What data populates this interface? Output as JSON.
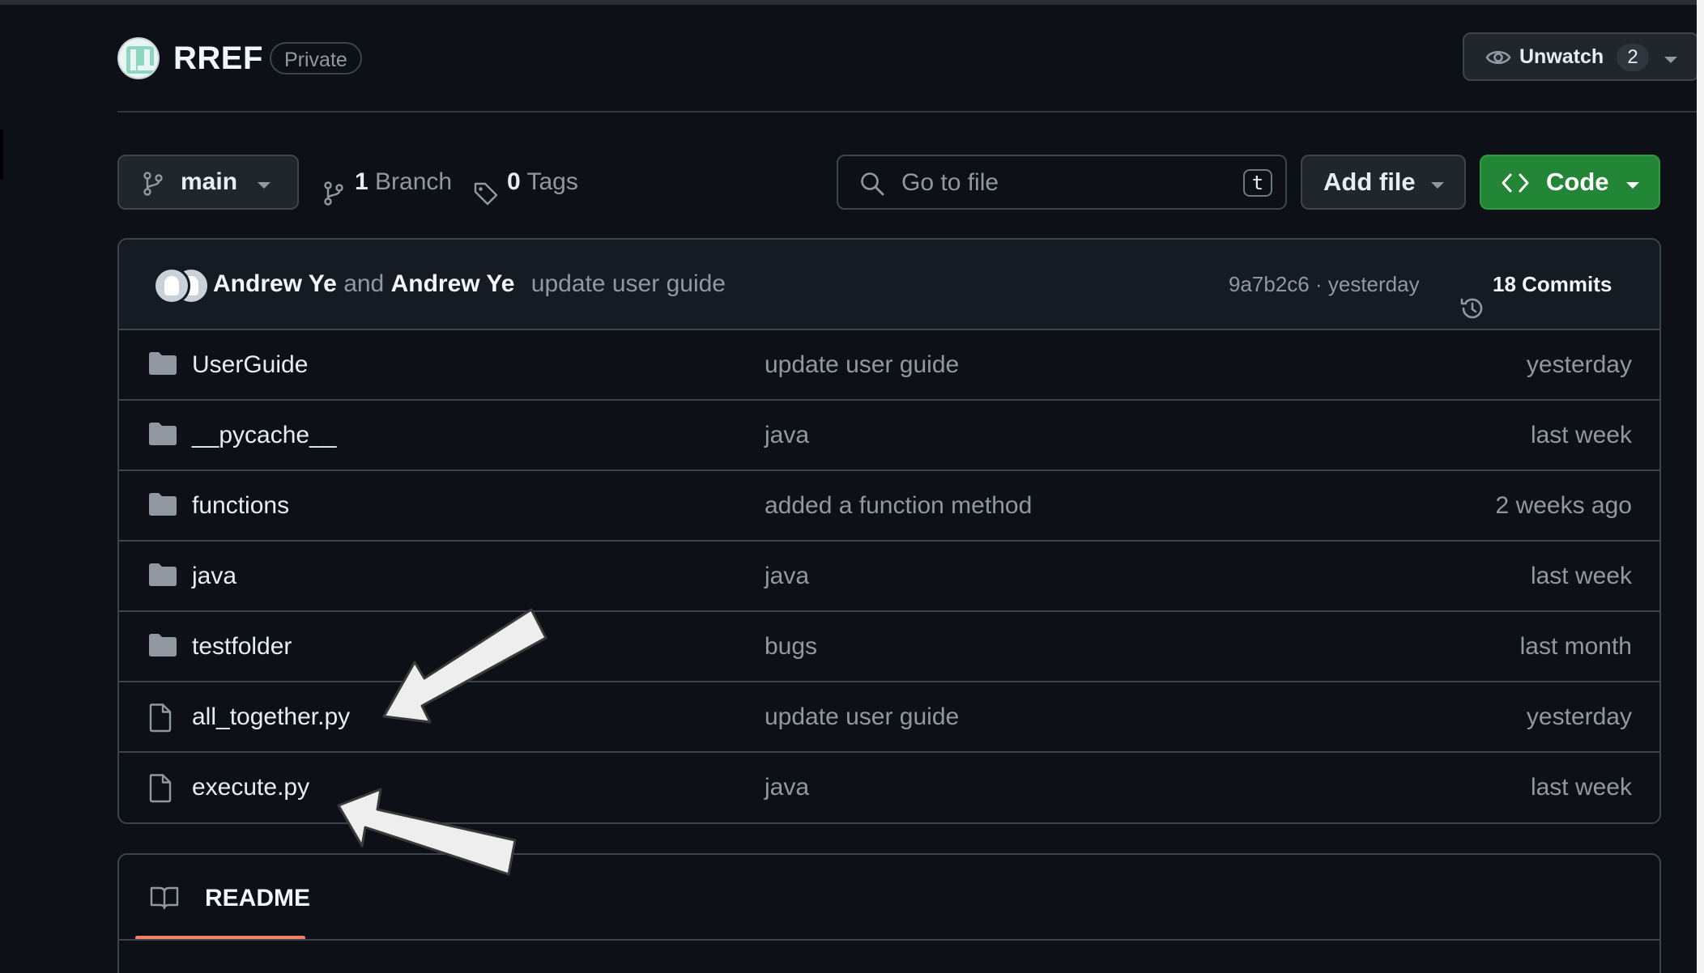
{
  "repo": {
    "name": "RREF",
    "visibility": "Private"
  },
  "watch": {
    "label": "Unwatch",
    "count": "2"
  },
  "toolbar": {
    "branch": "main",
    "branches_count": "1",
    "branches_label": "Branch",
    "tags_count": "0",
    "tags_label": "Tags",
    "search_placeholder": "Go to file",
    "search_shortcut": "t",
    "add_file_label": "Add file",
    "code_label": "Code"
  },
  "latest_commit": {
    "author1": "Andrew Ye",
    "conjunction": "and",
    "author2": "Andrew Ye",
    "message": "update user guide",
    "meta": "9a7b2c6 · yesterday",
    "commits_label": "18 Commits"
  },
  "files": [
    {
      "type": "folder",
      "name": "UserGuide",
      "message": "update user guide",
      "date": "yesterday"
    },
    {
      "type": "folder",
      "name": "__pycache__",
      "message": "java",
      "date": "last week"
    },
    {
      "type": "folder",
      "name": "functions",
      "message": "added a function method",
      "date": "2 weeks ago"
    },
    {
      "type": "folder",
      "name": "java",
      "message": "java",
      "date": "last week"
    },
    {
      "type": "folder",
      "name": "testfolder",
      "message": "bugs",
      "date": "last month"
    },
    {
      "type": "file",
      "name": "all_together.py",
      "message": "update user guide",
      "date": "yesterday"
    },
    {
      "type": "file",
      "name": "execute.py",
      "message": "java",
      "date": "last week"
    }
  ],
  "readme": {
    "tab_label": "README"
  },
  "colors": {
    "background": "#0d1117",
    "code_button": "#238636",
    "readme_underline": "#f78166",
    "annotation_arrow": "#eeeeee"
  }
}
